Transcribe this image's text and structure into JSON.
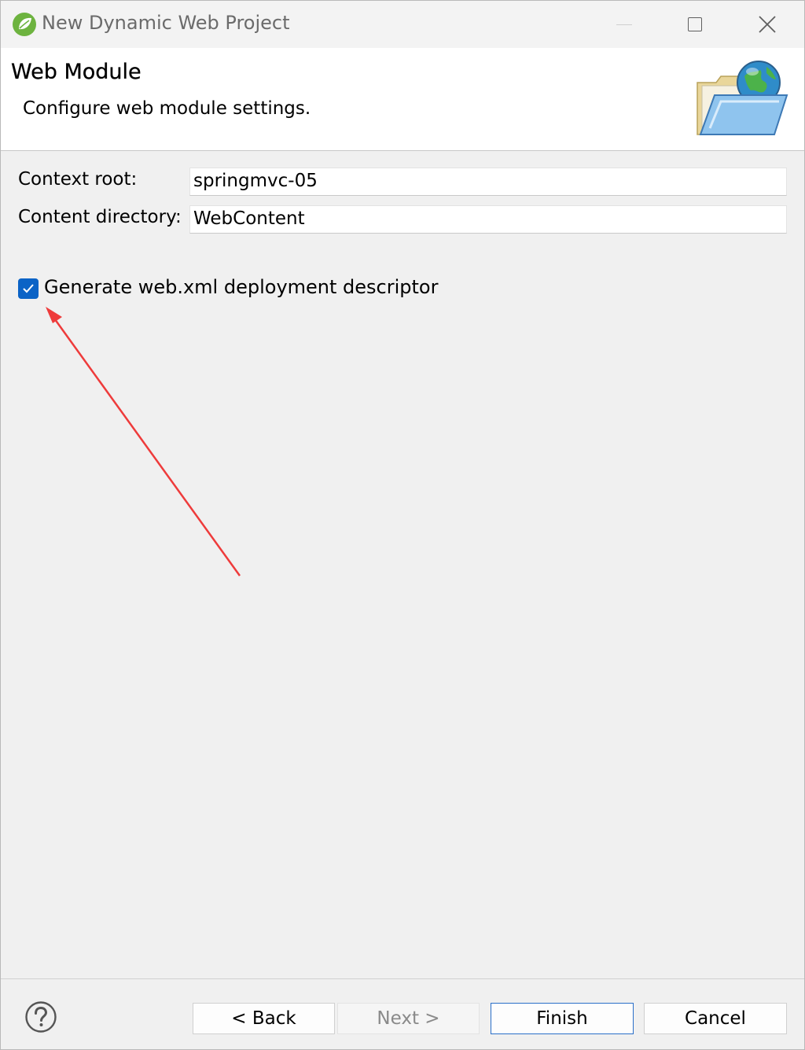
{
  "window": {
    "title": "New Dynamic Web Project",
    "app_icon": "spring-leaf-icon",
    "controls": [
      "minimize-icon",
      "maximize-icon",
      "close-icon"
    ]
  },
  "banner": {
    "title": "Web Module",
    "description": "Configure web module settings.",
    "icon": "web-folder-globe-icon"
  },
  "form": {
    "context_root": {
      "label": "Context root:",
      "value": "springmvc-05"
    },
    "content_directory": {
      "label": "Content directory:",
      "value": "WebContent"
    },
    "generate_web_xml": {
      "label": "Generate web.xml deployment descriptor",
      "checked": true
    }
  },
  "annotation": {
    "type": "red-arrow",
    "color": "#ee3b3b"
  },
  "footer": {
    "help_icon": "help-icon",
    "back": "< Back",
    "next": "Next >",
    "finish": "Finish",
    "cancel": "Cancel"
  },
  "colors": {
    "accent": "#0b63c6",
    "focus_border": "#2a6fc9",
    "disabled_text": "#8a8a8a"
  }
}
